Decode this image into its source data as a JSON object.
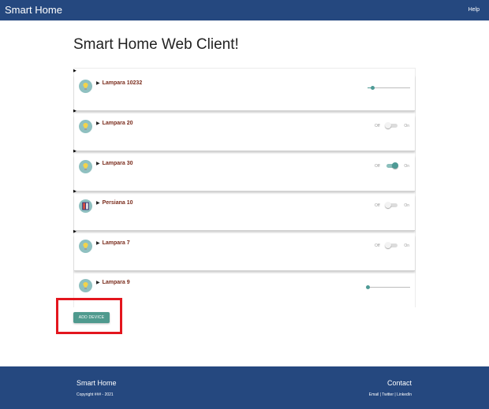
{
  "header": {
    "brand": "Smart Home",
    "help_label": "Help"
  },
  "page": {
    "title": "Smart Home Web Client!"
  },
  "devices": [
    {
      "name": "Lampara 10232",
      "type": "lamp",
      "control": "slider",
      "level": 0.12
    },
    {
      "name": "Lampara 20",
      "type": "lamp",
      "control": "switch",
      "off_label": "Off",
      "on_label": "On",
      "on": false
    },
    {
      "name": "Lampara 30",
      "type": "lamp",
      "control": "switch",
      "off_label": "Off",
      "on_label": "On",
      "on": true
    },
    {
      "name": "Persiana 10",
      "type": "blind",
      "control": "switch",
      "off_label": "Off",
      "on_label": "On",
      "on": false
    },
    {
      "name": "Lampara 7",
      "type": "lamp",
      "control": "switch",
      "off_label": "Off",
      "on_label": "On",
      "on": false
    },
    {
      "name": "Lampara 9",
      "type": "lamp",
      "control": "slider",
      "level": 0.0
    }
  ],
  "actions": {
    "add_device_label": "ADD DEVICE"
  },
  "footer": {
    "brand": "Smart Home",
    "copyright": "Copyright ### - 2021",
    "contact_title": "Contact",
    "links": [
      "Email",
      "Twitter",
      "LinkedIn"
    ]
  },
  "colors": {
    "navbar": "#25487f",
    "accent": "#4f9a8e",
    "device_name": "#7a2c1c",
    "highlight": "#e3161e"
  },
  "icons": {
    "lamp": "lightbulb-icon",
    "blind": "window-blind-icon"
  }
}
